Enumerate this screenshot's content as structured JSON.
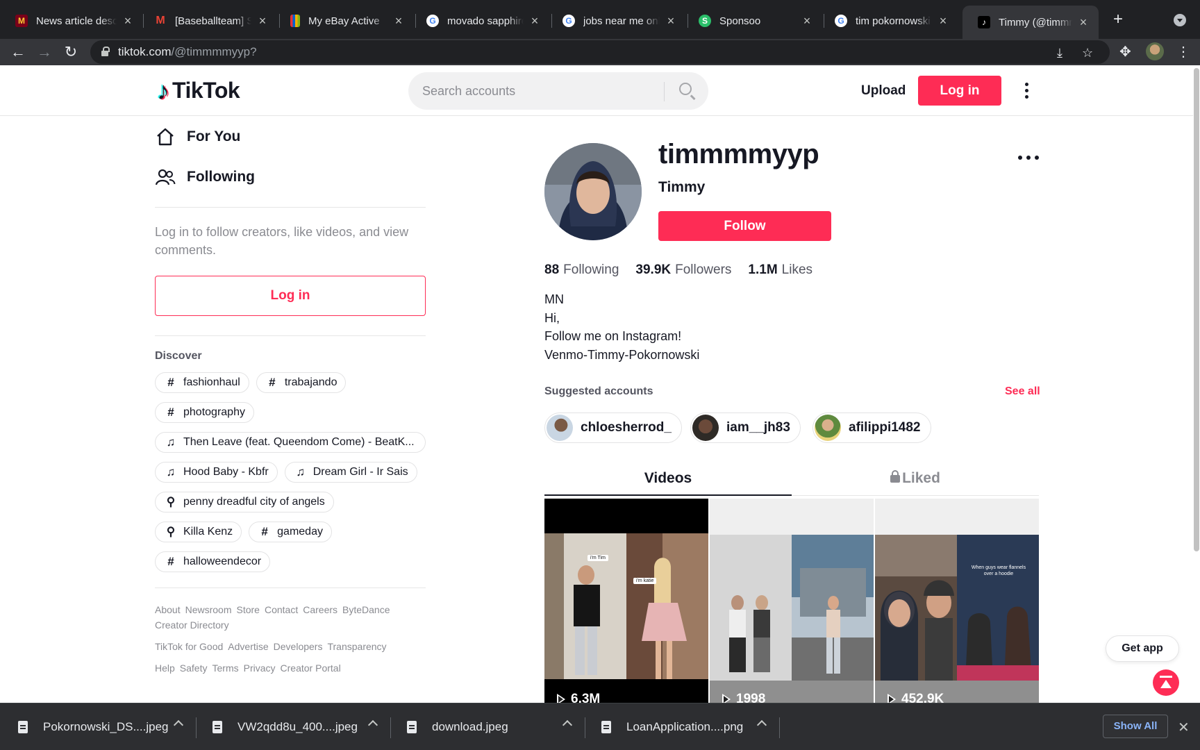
{
  "browser": {
    "tabs": [
      {
        "title": "News article desc",
        "favicon": "M"
      },
      {
        "title": "[Baseballteam] Sp",
        "favicon": "M"
      },
      {
        "title": "My eBay Active",
        "favicon": "e"
      },
      {
        "title": "movado sapphire",
        "favicon": "G"
      },
      {
        "title": "jobs near me onlin",
        "favicon": "G"
      },
      {
        "title": "Sponsoo",
        "favicon": "S"
      },
      {
        "title": "tim pokornowski -",
        "favicon": "G"
      },
      {
        "title": "Timmy (@timmmm",
        "favicon": "♪"
      }
    ],
    "url_host": "tiktok.com",
    "url_path": "/@timmmmyyp?"
  },
  "header": {
    "logo": "TikTok",
    "search_placeholder": "Search accounts",
    "upload_label": "Upload",
    "login_label": "Log in"
  },
  "sidebar": {
    "nav": [
      {
        "label": "For You",
        "icon": "home-icon"
      },
      {
        "label": "Following",
        "icon": "people-icon"
      }
    ],
    "login_prompt": "Log in to follow creators, like videos, and view comments.",
    "login_label": "Log in",
    "discover_title": "Discover",
    "discover_tags": [
      {
        "type": "hashtag",
        "text": "fashionhaul"
      },
      {
        "type": "hashtag",
        "text": "trabajando"
      },
      {
        "type": "hashtag",
        "text": "photography"
      },
      {
        "type": "music",
        "text": "Then Leave (feat. Queendom Come) - BeatK..."
      },
      {
        "type": "music",
        "text": "Hood Baby - Kbfr"
      },
      {
        "type": "music",
        "text": "Dream Girl - Ir Sais"
      },
      {
        "type": "search",
        "text": "penny dreadful city of angels"
      },
      {
        "type": "search",
        "text": "Killa Kenz"
      },
      {
        "type": "hashtag",
        "text": "gameday"
      },
      {
        "type": "hashtag",
        "text": "halloweendecor"
      }
    ],
    "footer_rows": [
      [
        "About",
        "Newsroom",
        "Store",
        "Contact",
        "Careers",
        "ByteDance"
      ],
      [
        "Creator Directory"
      ],
      [
        "TikTok for Good",
        "Advertise",
        "Developers",
        "Transparency"
      ],
      [
        "Help",
        "Safety",
        "Terms",
        "Privacy",
        "Creator Portal"
      ]
    ]
  },
  "profile": {
    "username": "timmmmyyp",
    "nickname": "Timmy",
    "follow_label": "Follow",
    "stats": [
      {
        "value": "88",
        "label": "Following"
      },
      {
        "value": "39.9K",
        "label": "Followers"
      },
      {
        "value": "1.1M",
        "label": "Likes"
      }
    ],
    "bio": [
      "MN",
      "Hi,",
      "Follow me on Instagram!",
      "Venmo-Timmy-Pokornowski"
    ],
    "suggested_title": "Suggested accounts",
    "see_all_label": "See all",
    "suggested": [
      {
        "name": "chloesherrod_"
      },
      {
        "name": "iam__jh83"
      },
      {
        "name": "afilippi1482"
      }
    ],
    "tabs": {
      "videos": "Videos",
      "liked": "Liked"
    },
    "videos": [
      {
        "views": "6.3M",
        "captions": [
          "i'm Tim",
          "i'm katie"
        ]
      },
      {
        "views": "1998",
        "captions": []
      },
      {
        "views": "452.9K",
        "captions": [
          "When guys wear flannels over a hoodie"
        ]
      }
    ]
  },
  "floating": {
    "get_app_label": "Get app"
  },
  "downloads": {
    "files": [
      "Pokornowski_DS....jpeg",
      "VW2qdd8u_400....jpeg",
      "download.jpeg",
      "LoanApplication....png"
    ],
    "show_all_label": "Show All"
  },
  "colors": {
    "brand": "#fe2c55",
    "text": "#161823",
    "muted": "#8a8b91"
  }
}
